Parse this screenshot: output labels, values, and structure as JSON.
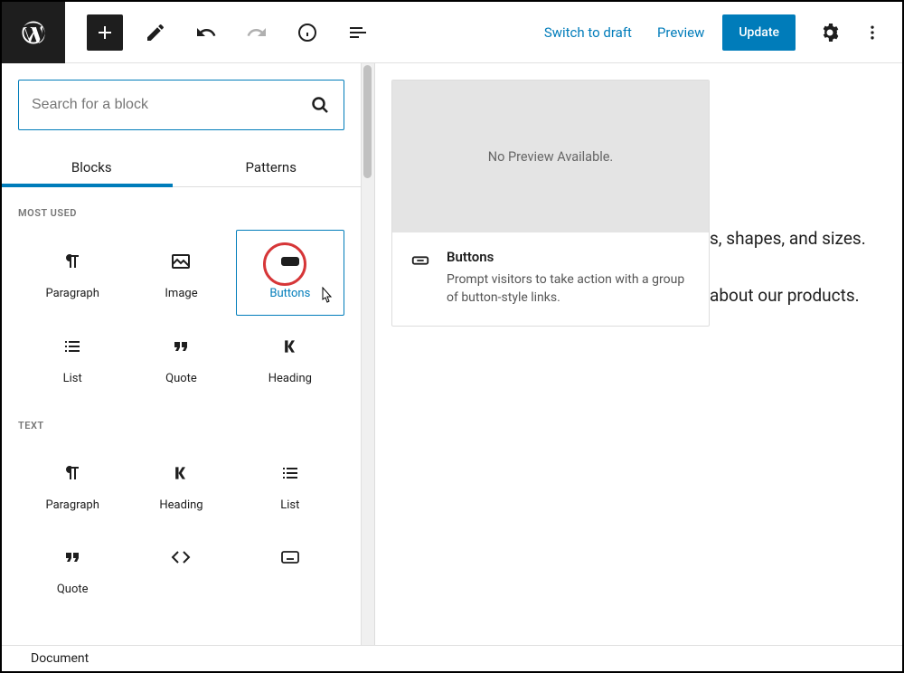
{
  "topbar": {
    "switch_draft": "Switch to draft",
    "preview": "Preview",
    "update": "Update"
  },
  "search": {
    "placeholder": "Search for a block"
  },
  "tabs": {
    "blocks": "Blocks",
    "patterns": "Patterns"
  },
  "categories": {
    "most_used": "MOST USED",
    "text": "TEXT"
  },
  "blocks": {
    "paragraph": "Paragraph",
    "image": "Image",
    "buttons": "Buttons",
    "list": "List",
    "quote": "Quote",
    "heading": "Heading",
    "code": "Code",
    "classic": "Classic"
  },
  "preview": {
    "empty": "No Preview Available.",
    "title": "Buttons",
    "desc": "Prompt visitors to take action with a group of button-style links."
  },
  "canvas": {
    "line1": "s, shapes, and sizes.",
    "line2": "about our products."
  },
  "footer": {
    "breadcrumb": "Document"
  }
}
